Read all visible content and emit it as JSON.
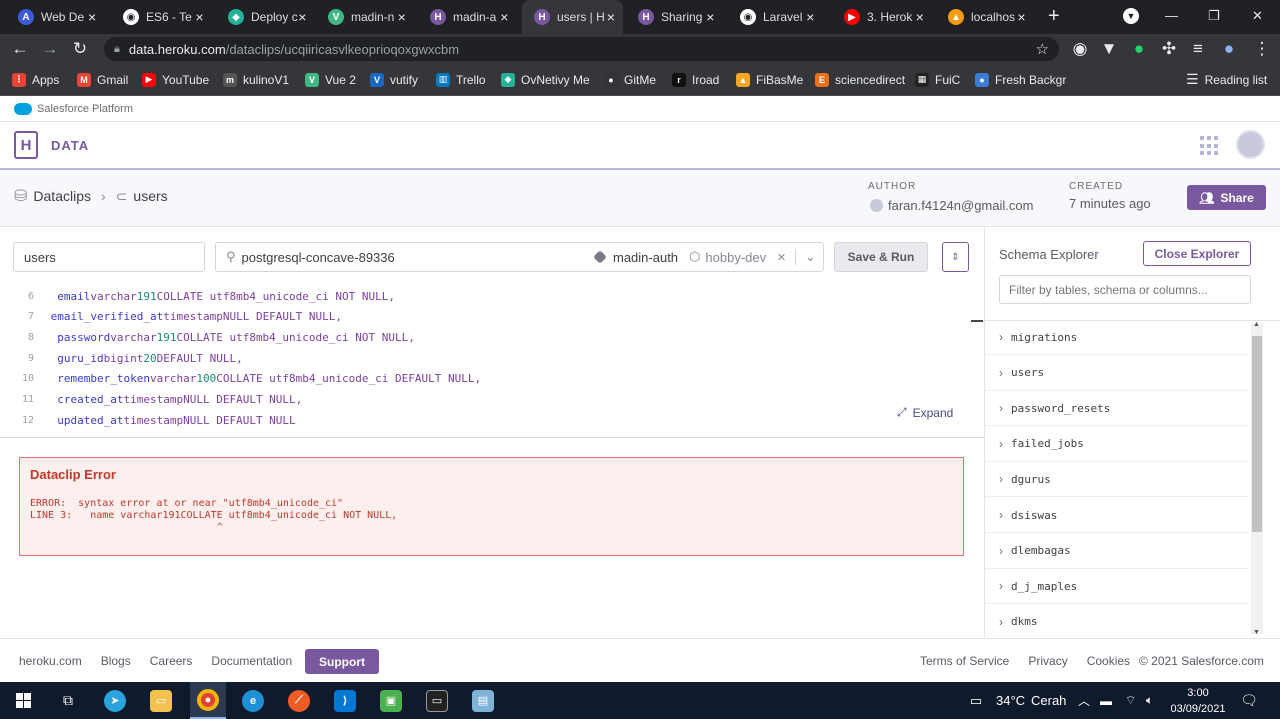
{
  "browser": {
    "tabs": [
      {
        "title": "Web De",
        "color": "#3b5bdb",
        "glyph": "A"
      },
      {
        "title": "ES6 - Te",
        "color": "#ffffff",
        "glyph": "◉"
      },
      {
        "title": "Deploy c",
        "color": "#24b29a",
        "glyph": "◆"
      },
      {
        "title": "madin-n",
        "color": "#41b883",
        "glyph": "V"
      },
      {
        "title": "madin-a",
        "color": "#79589f",
        "glyph": "H"
      },
      {
        "title": "users | H",
        "color": "#79589f",
        "glyph": "H"
      },
      {
        "title": "Sharing",
        "color": "#79589f",
        "glyph": "H"
      },
      {
        "title": "Laravel",
        "color": "#ffffff",
        "glyph": "◉"
      },
      {
        "title": "3. Herok",
        "color": "#ff0000",
        "glyph": "▶"
      },
      {
        "title": "localhos",
        "color": "#f39c12",
        "glyph": "▲"
      }
    ],
    "new_tab": "+",
    "url_host": "data.heroku.com",
    "url_path": "/dataclips/ucqiiricasvlkeoprioqoxgwxcbm",
    "bookmarks": [
      {
        "label": "Apps",
        "color": "#ea4335",
        "glyph": "⋮"
      },
      {
        "label": "Gmail",
        "color": "#ea4335",
        "glyph": "M"
      },
      {
        "label": "YouTube",
        "color": "#ff0000",
        "glyph": "▶"
      },
      {
        "label": "kulinoV1",
        "color": "#555555",
        "glyph": "m"
      },
      {
        "label": "Vue 2",
        "color": "#41b883",
        "glyph": "V"
      },
      {
        "label": "vutify",
        "color": "#1867c0",
        "glyph": "V"
      },
      {
        "label": "Trello",
        "color": "#0079bf",
        "glyph": "▥"
      },
      {
        "label": "OvNetivy Me",
        "color": "#24b29a",
        "glyph": "◆"
      },
      {
        "label": "GitMe",
        "color": "#333333",
        "glyph": "●"
      },
      {
        "label": "Iroad",
        "color": "#111111",
        "glyph": "r"
      },
      {
        "label": "FiBasMe",
        "color": "#f5a623",
        "glyph": "▲"
      },
      {
        "label": "sciencedirect",
        "color": "#e9711c",
        "glyph": "E"
      },
      {
        "label": "FuiC",
        "color": "#222222",
        "glyph": "▦"
      },
      {
        "label": "Fresh Backgr",
        "color": "#3d7bd9",
        "glyph": "●"
      }
    ],
    "reading_list": "Reading list"
  },
  "heroku": {
    "platform": "Salesforce Platform",
    "product": "DATA",
    "breadcrumb_root": "Dataclips",
    "breadcrumb_current": "users",
    "author_label": "AUTHOR",
    "author_value": "faran.f4124n@gmail.com",
    "created_label": "CREATED",
    "created_value": "7 minutes ago",
    "share_label": "Share",
    "clip_name": "users",
    "database": "postgresql-concave-89336",
    "app": "madin-auth",
    "plan": "hobby-dev",
    "save_run": "Save & Run",
    "expand": "Expand",
    "accent": "#79589f"
  },
  "code_lines": [
    {
      "n": "6",
      "indent": "  ",
      "name": "email",
      "type": "varchar",
      "num": "191",
      "rest": "COLLATE utf8mb4_unicode_ci NOT NULL,"
    },
    {
      "n": "7",
      "indent": " ",
      "name": "email_verified_at",
      "type": "timestamp",
      "num": "",
      "rest": "NULL DEFAULT NULL,"
    },
    {
      "n": "8",
      "indent": "  ",
      "name": "password",
      "type": "varchar",
      "num": "191",
      "rest": "COLLATE utf8mb4_unicode_ci NOT NULL,"
    },
    {
      "n": "9",
      "indent": "  ",
      "name": "guru_id",
      "type": "bigint",
      "num": "20",
      "rest": "DEFAULT NULL,"
    },
    {
      "n": "10",
      "indent": "  ",
      "name": "remember_token",
      "type": "varchar",
      "num": "100",
      "rest": "COLLATE utf8mb4_unicode_ci DEFAULT NULL,"
    },
    {
      "n": "11",
      "indent": "  ",
      "name": "created_at",
      "type": "timestamp",
      "num": "",
      "rest": "NULL DEFAULT NULL,"
    },
    {
      "n": "12",
      "indent": "  ",
      "name": "updated_at",
      "type": "timestamp",
      "num": "",
      "rest": "NULL DEFAULT NULL"
    }
  ],
  "error": {
    "title": "Dataclip Error",
    "line1": "ERROR:  syntax error at or near \"utf8mb4_unicode_ci\"",
    "line2": "LINE 3:   name varchar191COLLATE utf8mb4_unicode_ci NOT NULL,",
    "line3": "                               ^"
  },
  "explorer": {
    "title": "Schema Explorer",
    "close": "Close Explorer",
    "filter_placeholder": "Filter by tables, schema or columns...",
    "tables": [
      "migrations",
      "users",
      "password_resets",
      "failed_jobs",
      "dgurus",
      "dsiswas",
      "dlembagas",
      "d_j_maples",
      "dkms"
    ]
  },
  "footer": {
    "links_left": [
      "heroku.com",
      "Blogs",
      "Careers",
      "Documentation"
    ],
    "support": "Support",
    "links_right": [
      "Terms of Service",
      "Privacy",
      "Cookies"
    ],
    "copyright": "© 2021 Salesforce.com"
  },
  "taskbar": {
    "temperature": "34°C",
    "weather": "Cerah",
    "time": "3:00",
    "date": "03/09/2021"
  }
}
